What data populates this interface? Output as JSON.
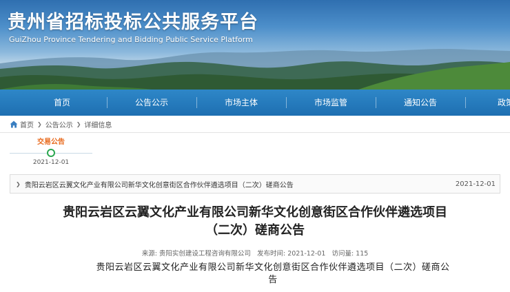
{
  "header": {
    "title": "贵州省招标投标公共服务平台",
    "subtitle": "GuiZhou Province Tendering and Bidding Public Service Platform"
  },
  "nav": {
    "items": [
      {
        "label": "首页"
      },
      {
        "label": "公告公示"
      },
      {
        "label": "市场主体"
      },
      {
        "label": "市场监管"
      },
      {
        "label": "通知公告"
      },
      {
        "label": "政策法"
      }
    ]
  },
  "breadcrumb": {
    "items": [
      "首页",
      "公告公示",
      "详细信息"
    ]
  },
  "timeline": {
    "label": "交易公告",
    "date": "2021-12-01"
  },
  "notice": {
    "title": "贵阳云岩区云翼文化产业有限公司新华文化创意街区合作伙伴遴选项目（二次）磋商公告",
    "date": "2021-12-01"
  },
  "article": {
    "title_line1": "贵阳云岩区云翼文化产业有限公司新华文化创意街区合作伙伴遴选项目",
    "title_line2": "（二次）磋商公告",
    "meta": {
      "source": "来源: 贵阳实创建设工程咨询有限公司",
      "publish_time": "发布时间: 2021-12-01",
      "views": "访问量: 115"
    },
    "body_line1": "贵阳云岩区云翼文化产业有限公司新华文化创意街区合作伙伴遴选项目（二次）磋商公",
    "body_line2": "告"
  },
  "colors": {
    "nav_blue": "#1e6fb1",
    "timeline_orange": "#e8681a",
    "timeline_green": "#2aa74f"
  }
}
